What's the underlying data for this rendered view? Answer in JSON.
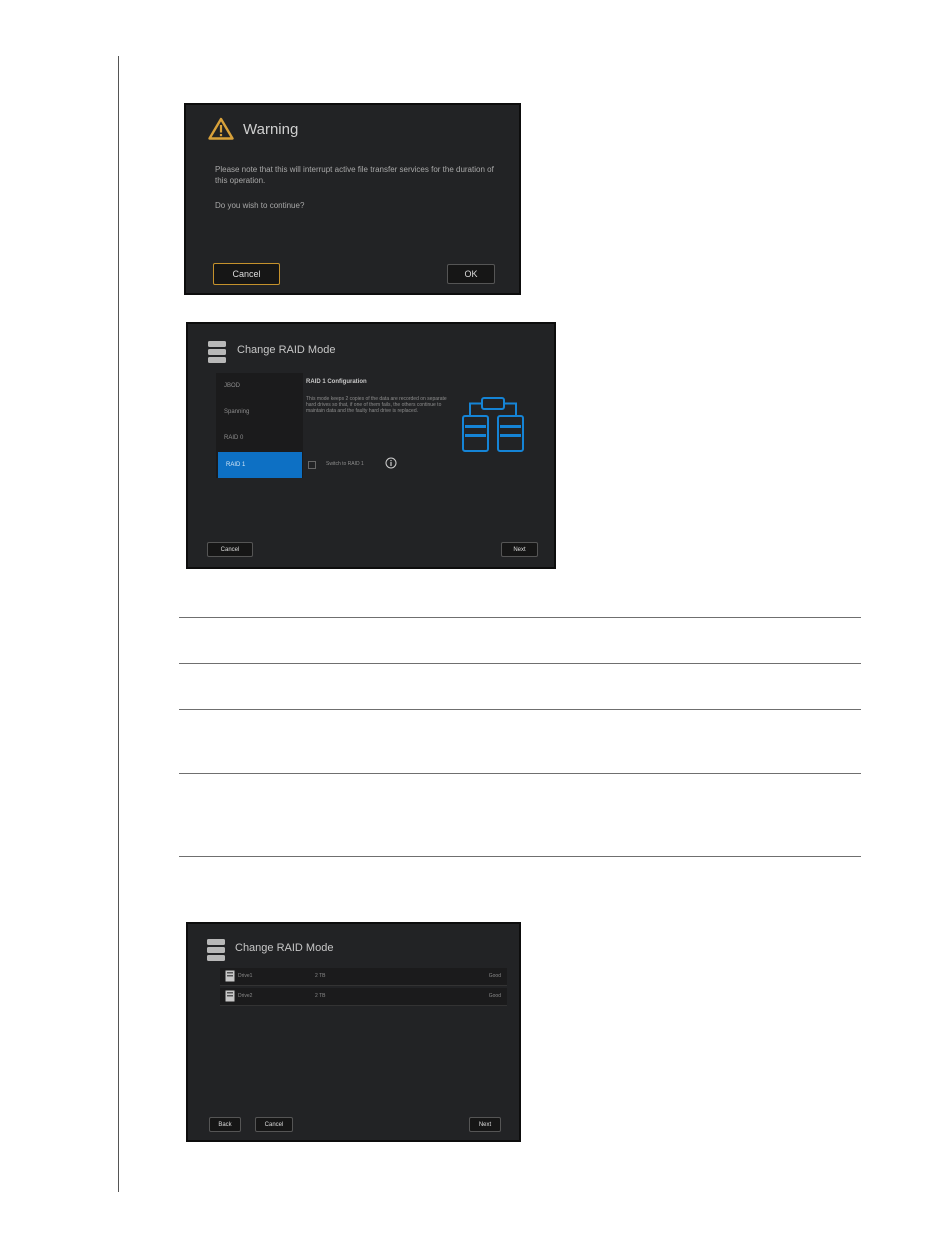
{
  "warning_dialog": {
    "title": "Warning",
    "message": "Please note that this will interrupt active file transfer services for the duration of this operation.",
    "question": "Do you wish to continue?",
    "cancel_label": "Cancel",
    "ok_label": "OK",
    "icon": "warning-triangle-icon",
    "accent": "#c4912c"
  },
  "raid_mode_dialog": {
    "title": "Change RAID Mode",
    "icon": "storage-stack-icon",
    "modes": [
      "JBOD",
      "Spanning",
      "RAID 0",
      "RAID 1"
    ],
    "selected_mode": "RAID 1",
    "config_title": "RAID 1 Configuration",
    "config_description": "This mode keeps 2 copies of the data are recorded on separate hard drives so that, if one of them fails, the others continue to maintain data and the faulty hard drive is replaced.",
    "checkbox_label": "Switch to RAID 1",
    "cancel_label": "Cancel",
    "next_label": "Next",
    "accent": "#0d70c4"
  },
  "drives_dialog": {
    "title": "Change RAID Mode",
    "icon": "storage-stack-icon",
    "drives": [
      {
        "name": "Drive1",
        "size": "2 TB",
        "status": "Good"
      },
      {
        "name": "Drive2",
        "size": "2 TB",
        "status": "Good"
      }
    ],
    "back_label": "Back",
    "cancel_label": "Cancel",
    "next_label": "Next"
  }
}
